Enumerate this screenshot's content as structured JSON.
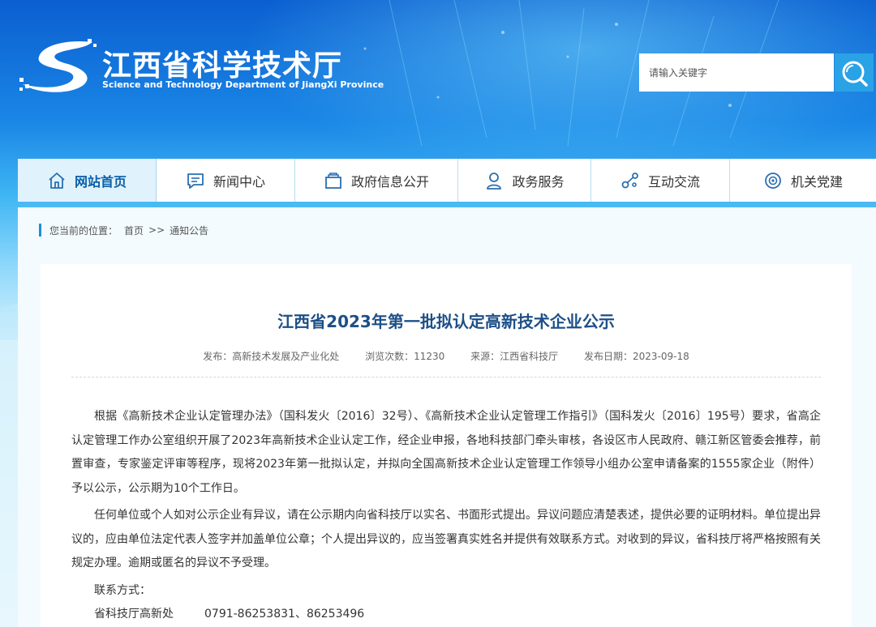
{
  "site": {
    "title_cn": "江西省科学技术厅",
    "title_en": "Science and Technology Department of JiangXi Province"
  },
  "search": {
    "placeholder": "请输入关键字"
  },
  "nav": {
    "items": [
      {
        "label": "网站首页",
        "icon": "home-icon",
        "active": true
      },
      {
        "label": "新闻中心",
        "icon": "message-icon",
        "active": false
      },
      {
        "label": "政府信息公开",
        "icon": "folder-icon",
        "active": false
      },
      {
        "label": "政务服务",
        "icon": "user-icon",
        "active": false
      },
      {
        "label": "互动交流",
        "icon": "share-icon",
        "active": false
      },
      {
        "label": "机关党建",
        "icon": "badge-icon",
        "active": false
      }
    ]
  },
  "breadcrumb": {
    "prefix": "您当前的位置：",
    "home": "首页",
    "sep": ">>",
    "current": "通知公告"
  },
  "article": {
    "title": "江西省2023年第一批拟认定高新技术企业公示",
    "meta": {
      "publisher": "发布：高新技术发展及产业化处",
      "views": "浏览次数：11230",
      "source": "来源：江西省科技厅",
      "date": "发布日期：2023-09-18"
    },
    "paragraphs": [
      "根据《高新技术企业认定管理办法》（国科发火〔2016〕32号）、《高新技术企业认定管理工作指引》（国科发火〔2016〕195号）要求，省高企认定管理工作办公室组织开展了2023年高新技术企业认定工作，经企业申报，各地科技部门牵头审核，各设区市人民政府、赣江新区管委会推荐，前置审查，专家鉴定评审等程序，现将2023年第一批拟认定，并拟向全国高新技术企业认定管理工作领导小组办公室申请备案的1555家企业（附件）予以公示，公示期为10个工作日。",
      "任何单位或个人如对公示企业有异议，请在公示期内向省科技厅以实名、书面形式提出。异议问题应清楚表述，提供必要的证明材料。单位提出异议的，应由单位法定代表人签字并加盖单位公章；个人提出异议的，应当签署真实姓名并提供有效联系方式。对收到的异议，省科技厅将严格按照有关规定办理。逾期或匿名的异议不予受理。"
    ],
    "contact_label": "联系方式：",
    "contact": {
      "dept": "省科技厅高新处",
      "phone": "0791-86253831、86253496"
    }
  },
  "colors": {
    "brand_blue": "#0b5fd0",
    "title_blue": "#1d4f87",
    "accent": "#2aa2e6"
  }
}
